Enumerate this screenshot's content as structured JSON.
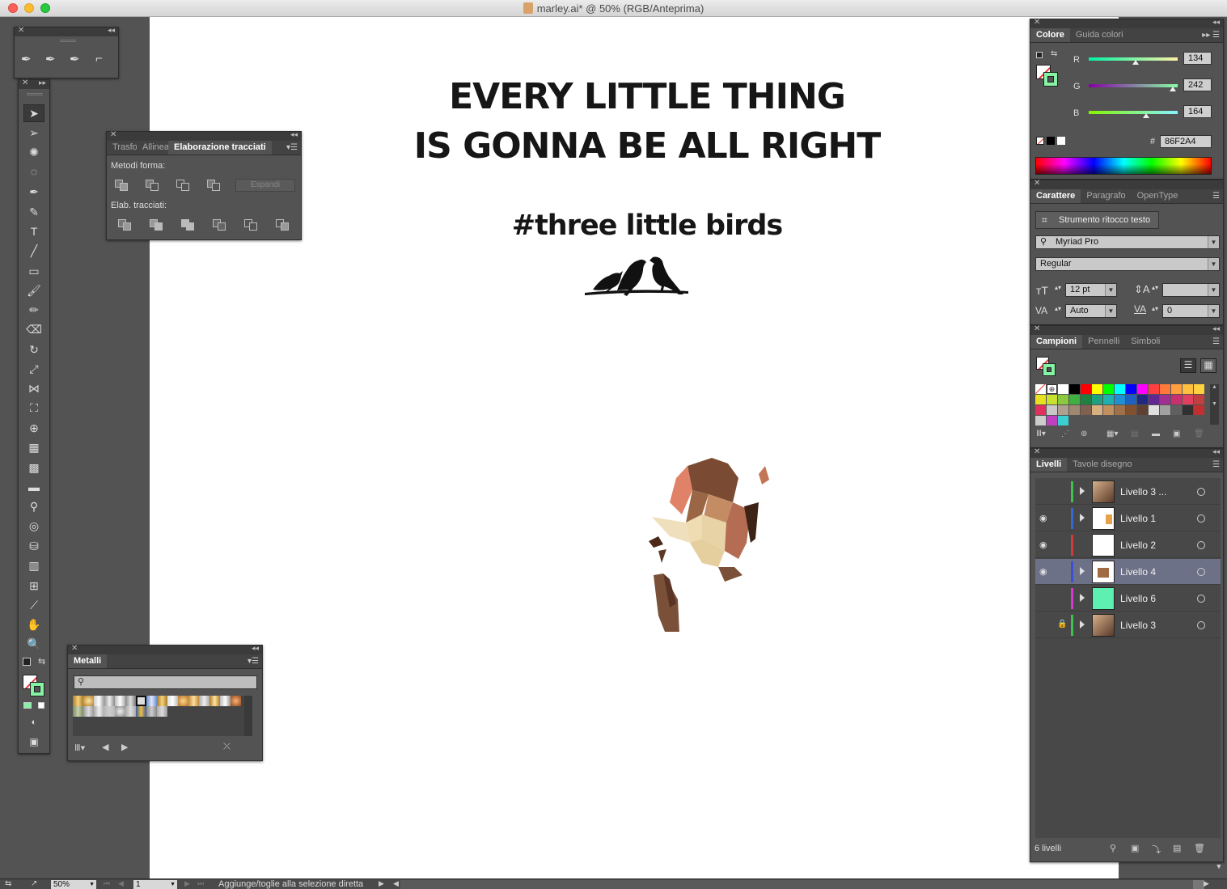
{
  "window": {
    "title": "marley.ai* @ 50% (RGB/Anteprima)"
  },
  "artboard": {
    "heading_line1": "EVERY LITTLE THING",
    "heading_line2": "IS GONNA BE ALL RIGHT",
    "hashtag": "#three little birds"
  },
  "pathfinder": {
    "tabs": [
      "Trasfo",
      "Allinea",
      "Elaborazione tracciati"
    ],
    "shape_modes_label": "Metodi forma:",
    "expand_button": "Espandi",
    "pathfinders_label": "Elab. tracciati:"
  },
  "metals": {
    "tab": "Metalli",
    "search_placeholder": ""
  },
  "color": {
    "tabs": [
      "Colore",
      "Guida colori"
    ],
    "r_label": "R",
    "r": "134",
    "g_label": "G",
    "g": "242",
    "b_label": "B",
    "b": "164",
    "r_level": 0.525,
    "g_level": 0.949,
    "b_level": 0.643,
    "hash": "#",
    "hex": "86F2A4",
    "fill_color": "#86F2A4"
  },
  "character": {
    "tabs": [
      "Carattere",
      "Paragrafo",
      "OpenType"
    ],
    "touch_type_button": "Strumento ritocco testo",
    "font_family": "Myriad Pro",
    "font_style": "Regular",
    "font_size": "12 pt",
    "leading": "",
    "kerning": "Auto",
    "tracking": "0"
  },
  "swatches": {
    "tabs": [
      "Campioni",
      "Pennelli",
      "Simboli"
    ]
  },
  "layers": {
    "tabs": [
      "Livelli",
      "Tavole disegno"
    ],
    "count_label": "6 livelli",
    "rows": [
      {
        "name": "Livello 3 ...",
        "color": "#3fc24e",
        "visible": false,
        "locked": false,
        "thumb": "portrait"
      },
      {
        "name": "Livello 1",
        "color": "#3a67d6",
        "visible": true,
        "locked": false,
        "thumb": "white-sketch"
      },
      {
        "name": "Livello 2",
        "color": "#d63a3a",
        "visible": true,
        "locked": false,
        "thumb": "white"
      },
      {
        "name": "Livello 4",
        "color": "#3a4ed6",
        "visible": true,
        "locked": false,
        "thumb": "lowpoly"
      },
      {
        "name": "Livello 6",
        "color": "#d63ad0",
        "visible": false,
        "locked": false,
        "thumb": "mint"
      },
      {
        "name": "Livello 3",
        "color": "#3fc24e",
        "visible": false,
        "locked": true,
        "thumb": "portrait"
      }
    ]
  },
  "status": {
    "zoom": "50%",
    "page": "1",
    "message": "Aggiunge/toglie alla selezione diretta"
  }
}
